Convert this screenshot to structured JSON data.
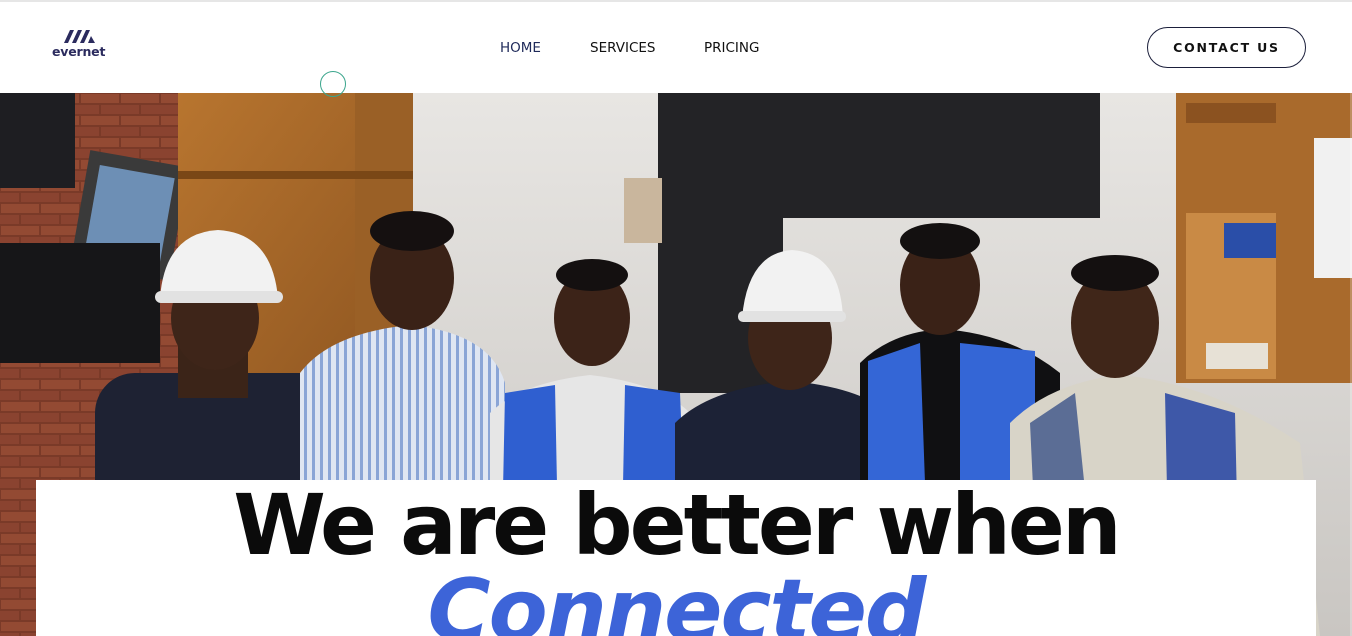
{
  "brand": {
    "name": "evernet",
    "logo_icon": "evernet-logo-icon",
    "color": "#2b2b5e"
  },
  "nav": {
    "items": [
      {
        "label": "HOME",
        "active": true
      },
      {
        "label": "SERVICES",
        "active": false
      },
      {
        "label": "PRICING",
        "active": false
      }
    ]
  },
  "header": {
    "cta_label": "CONTACT US"
  },
  "hero": {
    "headline": "We are better when",
    "headline_accent": "Connected",
    "accent_color": "#3d64d8",
    "photo_subject": "team-photo"
  }
}
